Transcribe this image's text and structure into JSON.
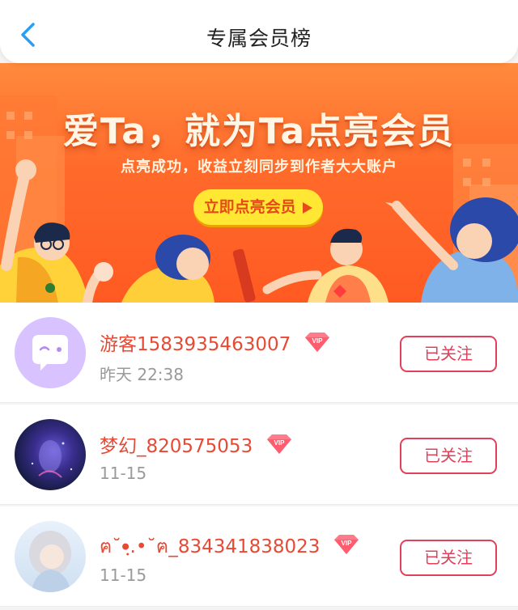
{
  "header": {
    "title": "专属会员榜"
  },
  "banner": {
    "headline": "爱Ta，就为Ta点亮会员",
    "subtitle": "点亮成功，收益立刻同步到作者大大账户",
    "cta_label": "立即点亮会员"
  },
  "members": [
    {
      "name": "游客1583935463007",
      "vip_badge": "VIP",
      "time": "昨天 22:38",
      "follow_label": "已关注"
    },
    {
      "name": "梦幻_820575053",
      "vip_badge": "VIP",
      "time": "11-15",
      "follow_label": "已关注"
    },
    {
      "name": "ฅ˘•ฺ.•˘ฅ_834341838023",
      "vip_badge": "VIP",
      "time": "11-15",
      "follow_label": "已关注"
    }
  ],
  "colors": {
    "accent_red": "#e23f5a",
    "name_red": "#e64a35",
    "banner_orange": "#ff6a2b",
    "cta_yellow": "#ffe733",
    "back_blue": "#2a9df4"
  },
  "icons": [
    "chevron-left-icon",
    "vip-diamond-icon",
    "play-triangle-icon",
    "chat-bubble-icon"
  ]
}
